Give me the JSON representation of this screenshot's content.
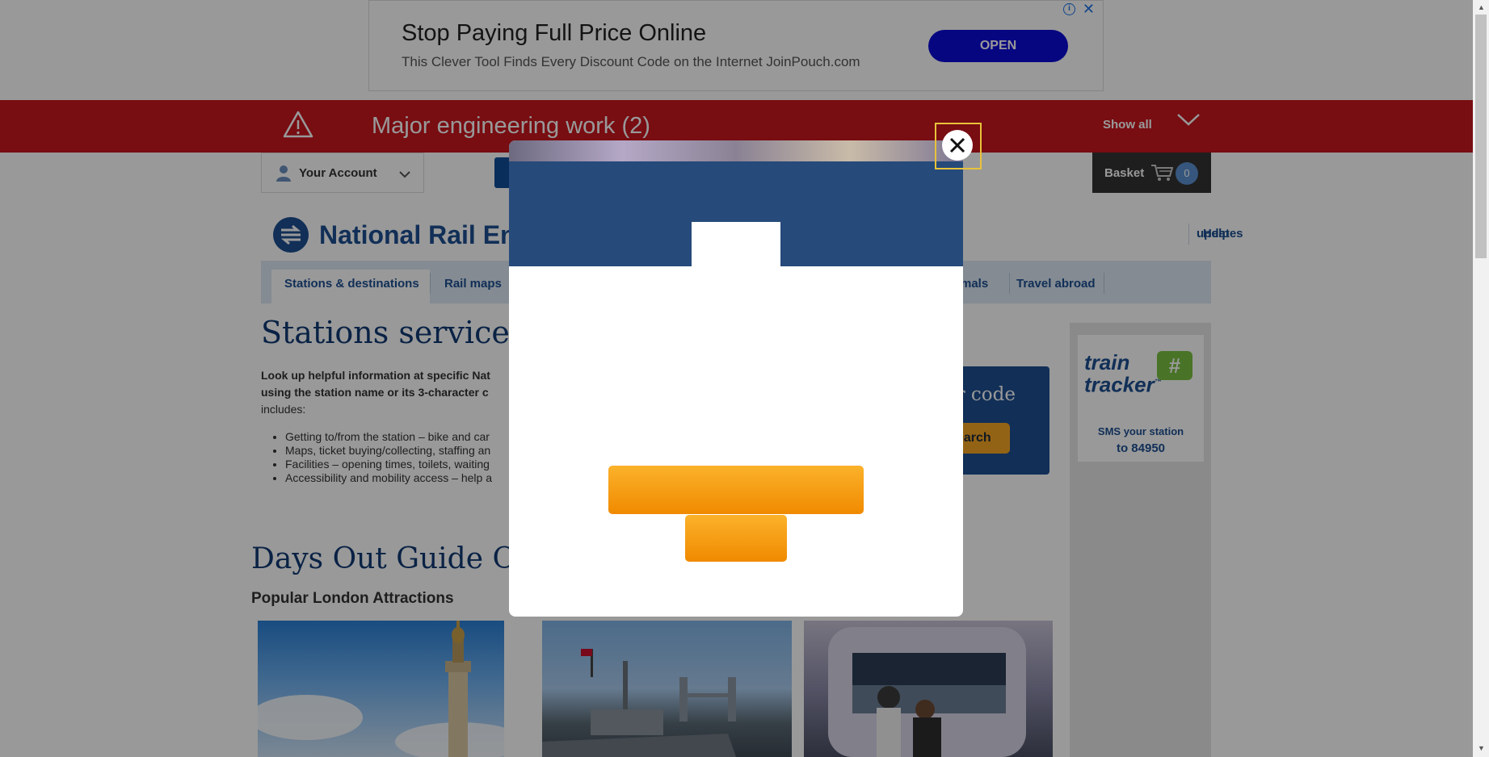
{
  "ad": {
    "title": "Stop Paying Full Price Online",
    "subtitle": "This Clever Tool Finds Every Discount Code on the Internet JoinPouch.com",
    "open_label": "OPEN",
    "info_glyph": "i",
    "close_glyph": "✕",
    "icons": [
      "info-icon",
      "close-icon"
    ]
  },
  "alert": {
    "title": "Major engineering work (2)",
    "show_all": "Show all",
    "icon": "warning-icon"
  },
  "account": {
    "label": "Your Account"
  },
  "basket": {
    "label": "Basket",
    "count": "0"
  },
  "header": {
    "logo_text": "National Rail Enq",
    "links": [
      "updates",
      "Help"
    ]
  },
  "nav": {
    "items": [
      "Stations & destinations",
      "Rail maps",
      "mals",
      "Travel abroad"
    ]
  },
  "main": {
    "title": "Stations services a",
    "intro_line1": "Look up helpful information at specific Nat",
    "intro_line2": "using the station name or its 3-character c",
    "intro_line3": "includes:",
    "bullets": [
      "Getting to/from the station – bike and car",
      "Maps, ticket buying/collecting, staffing an",
      "Facilities – opening times, toilets, waiting",
      "Accessibility and mobility access – help a"
    ],
    "search_title": "er code",
    "search_button": "earch"
  },
  "sidebar": {
    "tt_logo_line1": "train",
    "tt_logo_line2": "tracker",
    "tt_hash": "#",
    "tt_tm": "™",
    "sms_line1": "SMS your station",
    "sms_line2": "to 84950"
  },
  "days_out": {
    "title": "Days Out Guide Of",
    "subtitle": "Popular London Attractions"
  },
  "modal": {
    "close_glyph": "✕"
  },
  "colors": {
    "alert_red": "#c8171e",
    "brand_blue": "#1d4f91",
    "modal_header": "#264a7a",
    "cta_orange": "#f5a623",
    "ad_button": "#0a0ad8"
  }
}
